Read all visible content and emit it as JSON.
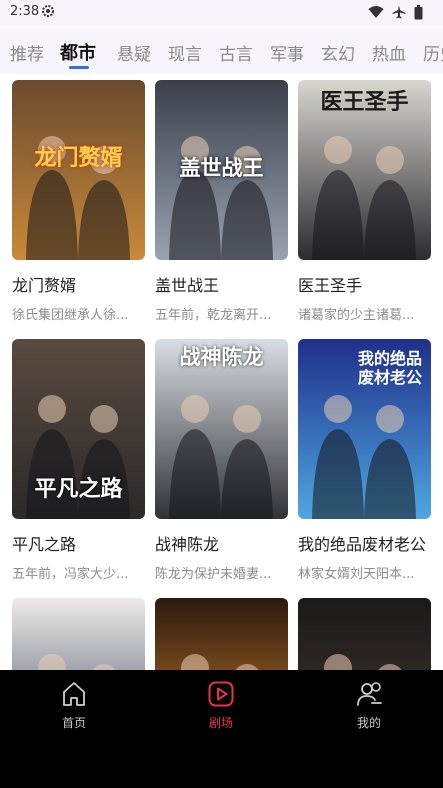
{
  "status": {
    "time": "2:38",
    "icons": [
      "gear-icon",
      "wifi-icon",
      "airplane-icon",
      "battery-icon"
    ]
  },
  "tabs": [
    {
      "label": "推荐",
      "active": false
    },
    {
      "label": "都市",
      "active": true
    },
    {
      "label": "悬疑",
      "active": false
    },
    {
      "label": "现言",
      "active": false
    },
    {
      "label": "古言",
      "active": false
    },
    {
      "label": "军事",
      "active": false
    },
    {
      "label": "玄幻",
      "active": false
    },
    {
      "label": "热血",
      "active": false
    },
    {
      "label": "历史",
      "active": false
    }
  ],
  "dramas": [
    {
      "title": "龙门赘婿",
      "desc": "徐氏集团继承人徐...",
      "poster_text": "龙门赘婿",
      "colors": [
        "#6b4a2e",
        "#c98a3a"
      ]
    },
    {
      "title": "盖世战王",
      "desc": "五年前，乾龙离开...",
      "poster_text": "盖世战王",
      "colors": [
        "#3a3f4a",
        "#9aa3b2"
      ]
    },
    {
      "title": "医王圣手",
      "desc": "诸葛家的少主诸葛...",
      "poster_text": "医王圣手",
      "colors": [
        "#d9d6d0",
        "#2b2b30"
      ]
    },
    {
      "title": "平凡之路",
      "desc": "五年前，冯家大少...",
      "poster_text": "平凡之路",
      "colors": [
        "#5a4a3f",
        "#2a2a2a"
      ]
    },
    {
      "title": "战神陈龙",
      "desc": "陈龙为保护未婚妻...",
      "poster_text": "战神陈龙",
      "colors": [
        "#d8dde3",
        "#303236"
      ]
    },
    {
      "title": "我的绝品废材老公",
      "desc": "林家女婿刘天阳本...",
      "poster_text": "我的绝品废材老公",
      "colors": [
        "#1f2f8a",
        "#4fa7e0"
      ]
    },
    {
      "title": "",
      "desc": "",
      "poster_text": "",
      "colors": [
        "#efeae6",
        "#2a3b5a"
      ]
    },
    {
      "title": "",
      "desc": "",
      "poster_text": "",
      "colors": [
        "#2b1a10",
        "#e08a2a"
      ]
    },
    {
      "title": "",
      "desc": "",
      "poster_text": "",
      "colors": [
        "#1a1a1a",
        "#4a3a30"
      ]
    }
  ],
  "nav": [
    {
      "label": "首页",
      "icon": "home-icon",
      "active": false
    },
    {
      "label": "剧场",
      "icon": "play-icon",
      "active": true
    },
    {
      "label": "我的",
      "icon": "profile-icon",
      "active": false
    }
  ],
  "accent": "#e8324a",
  "tab_indicator_color": "#2f6fe8"
}
